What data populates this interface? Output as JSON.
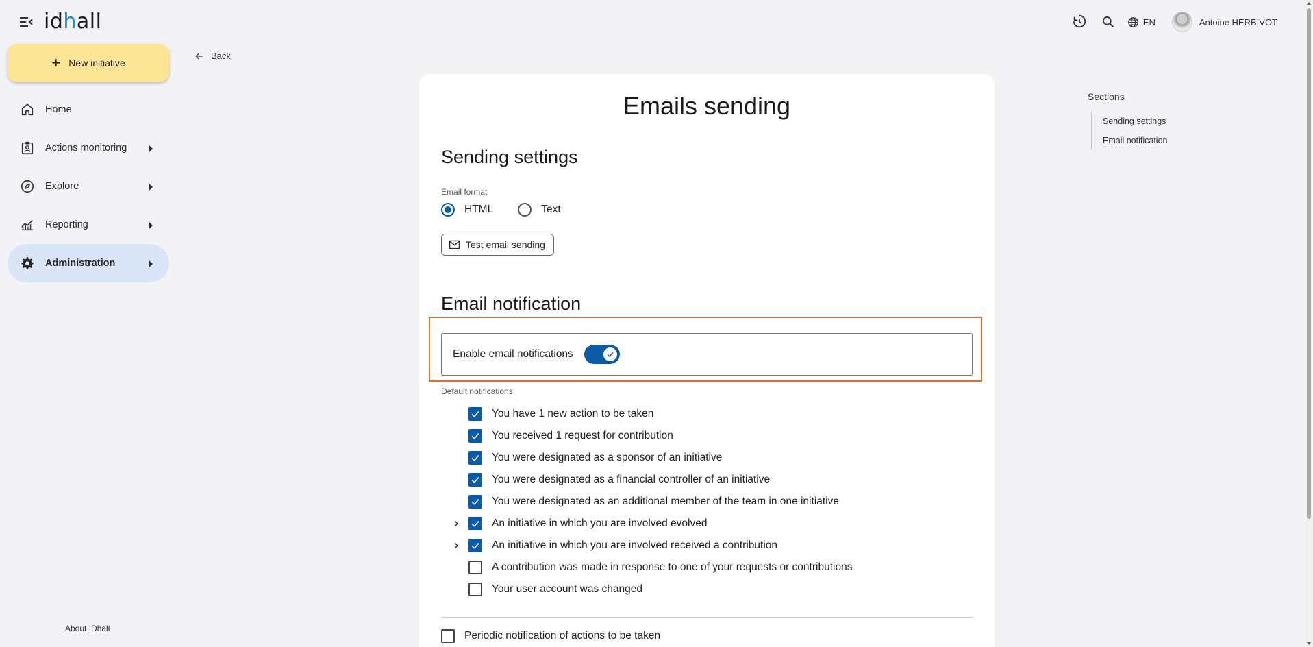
{
  "header": {
    "logo_text_1": "id",
    "logo_dot": "h",
    "logo_text_2": "all",
    "language": "EN",
    "user_name": "Antoine HERBIVOT",
    "icons": [
      "menu-collapse-icon",
      "history-icon",
      "search-icon",
      "globe-icon"
    ]
  },
  "sidebar": {
    "new_button_label": "New initiative",
    "items": [
      {
        "label": "Home",
        "icon": "home-icon"
      },
      {
        "label": "Actions monitoring",
        "icon": "clipboard-user-icon"
      },
      {
        "label": "Explore",
        "icon": "compass-icon"
      },
      {
        "label": "Reporting",
        "icon": "chart-icon"
      },
      {
        "label": "Administration",
        "icon": "gear-icon"
      }
    ],
    "about_label": "About IDhall"
  },
  "back_label": "Back",
  "main": {
    "title": "Emails sending",
    "sending_settings": {
      "heading": "Sending settings",
      "format_label": "Email format",
      "options": [
        "HTML",
        "Text"
      ],
      "selected": "HTML",
      "test_button_label": "Test email sending"
    },
    "email_notification": {
      "heading": "Email notification",
      "enable_label": "Enable email notifications",
      "enabled": true,
      "default_label": "Default notifications",
      "items": [
        {
          "label": "You have 1 new action to be taken",
          "checked": true,
          "expandable": false
        },
        {
          "label": "You received 1 request for contribution",
          "checked": true,
          "expandable": false
        },
        {
          "label": "You were designated as a sponsor of an initiative",
          "checked": true,
          "expandable": false
        },
        {
          "label": "You were designated as a financial controller of an initiative",
          "checked": true,
          "expandable": false
        },
        {
          "label": "You were designated as an additional member of the team in one initiative",
          "checked": true,
          "expandable": false
        },
        {
          "label": "An initiative in which you are involved evolved",
          "checked": true,
          "expandable": true
        },
        {
          "label": "An initiative in which you are involved received a contribution",
          "checked": true,
          "expandable": true
        },
        {
          "label": "A contribution was made in response to one of your requests or contributions",
          "checked": false,
          "expandable": false
        },
        {
          "label": "Your user account was changed",
          "checked": false,
          "expandable": false
        }
      ],
      "periodic_label": "Periodic notification of actions to be taken",
      "periodic_checked": false
    }
  },
  "sections": {
    "title": "Sections",
    "links": [
      "Sending settings",
      "Email notification"
    ]
  },
  "colors": {
    "accent": "#0b5aa5",
    "highlight": "#f26a1b",
    "new_button": "#fde596",
    "active_nav": "#dae6f7"
  }
}
